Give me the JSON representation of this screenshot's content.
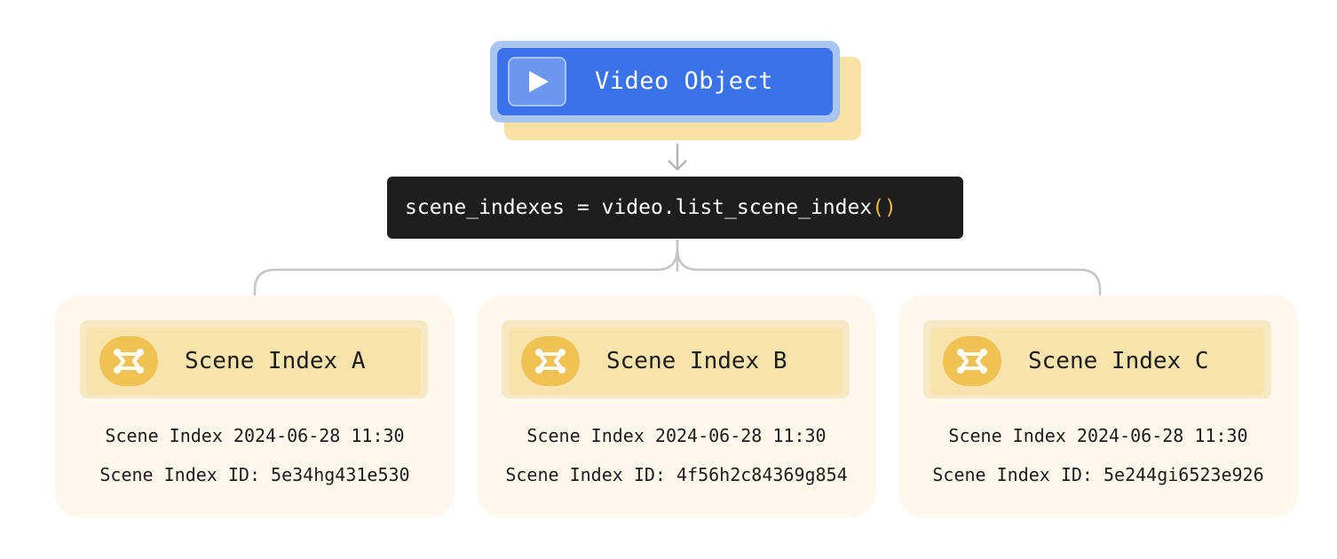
{
  "video_object": {
    "label": "Video Object",
    "icon": "play-icon"
  },
  "code": {
    "text": "scene_indexes = video.list_scene_index",
    "parens": "()"
  },
  "scene_indexes": [
    {
      "title": "Scene Index A",
      "line1": "Scene Index 2024-06-28 11:30",
      "line2": "Scene Index ID: 5e34hg431e530"
    },
    {
      "title": "Scene Index B",
      "line1": "Scene Index 2024-06-28 11:30",
      "line2": "Scene Index ID: 4f56h2c84369g854"
    },
    {
      "title": "Scene Index C",
      "line1": "Scene Index 2024-06-28 11:30",
      "line2": "Scene Index ID: 5e244gi6523e926"
    }
  ],
  "colors": {
    "video_blue": "#3a72ea",
    "code_bg": "#1e1e1e",
    "paren_accent": "#f3b63a",
    "card_bg": "#fdf7ec",
    "header_yellow": "#f8e3ac",
    "icon_yellow": "#f0c254"
  }
}
